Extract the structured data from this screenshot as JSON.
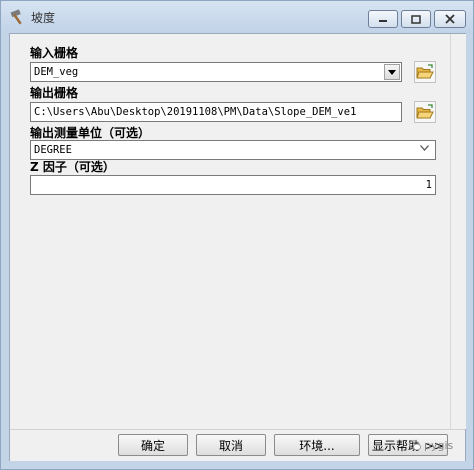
{
  "window": {
    "title": "坡度"
  },
  "input_raster": {
    "label": "输入栅格",
    "value": "DEM_veg"
  },
  "output_raster": {
    "label": "输出栅格",
    "value": "C:\\Users\\Abu\\Desktop\\20191108\\PM\\Data\\Slope_DEM_ve1"
  },
  "units": {
    "label": "输出测量单位（可选）",
    "value": "DEGREE"
  },
  "zfactor": {
    "label": "Z 因子（可选）",
    "value": "1"
  },
  "buttons": {
    "ok": "确定",
    "cancel": "取消",
    "env": "环境...",
    "help": "显示帮助 >>"
  },
  "watermark": "pygis"
}
